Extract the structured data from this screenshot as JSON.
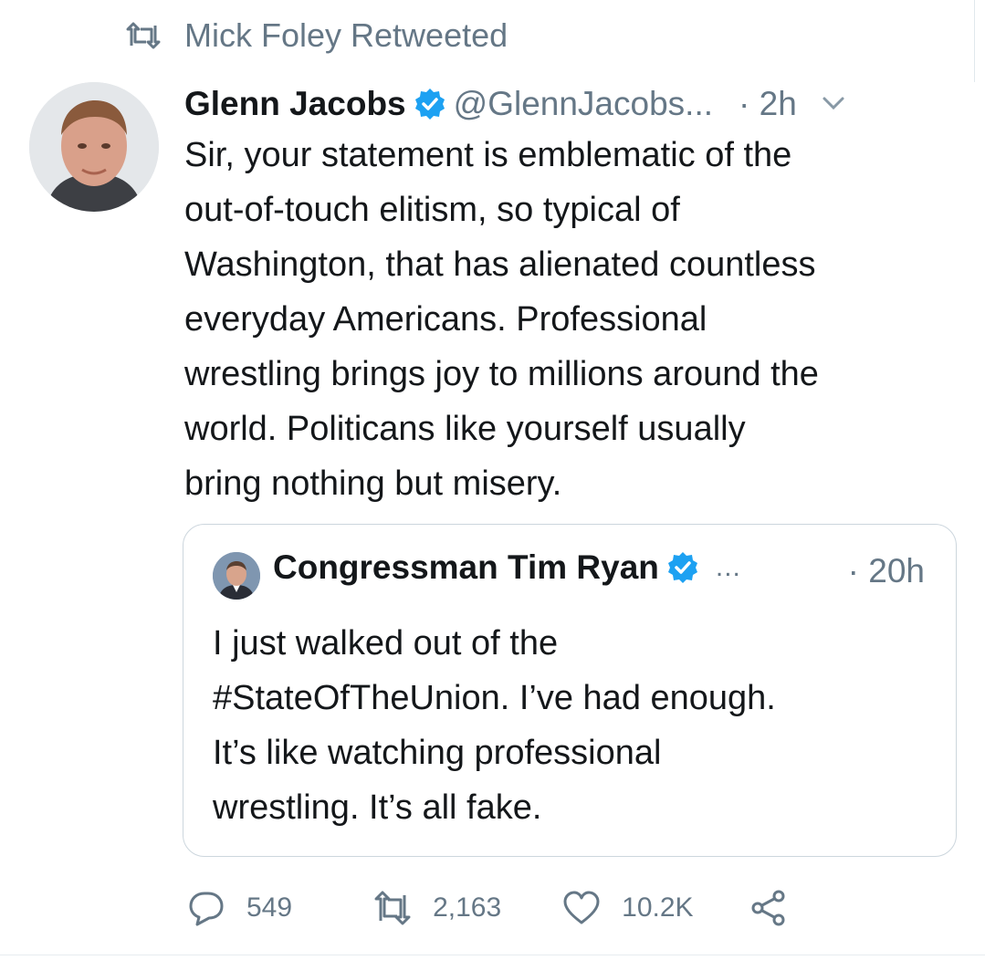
{
  "retweet_header": {
    "text": "Mick Foley Retweeted",
    "icon": "retweet-icon"
  },
  "tweet": {
    "display_name": "Glenn Jacobs",
    "verified": true,
    "handle": "@GlennJacobs...",
    "time": "· 2h",
    "text_lines": [
      "Sir, your statement is emblematic of the",
      "out-of-touch elitism, so typical of",
      "Washington, that has alienated countless",
      "everyday Americans. Professional",
      "wrestling brings joy to millions around the",
      "world. Politicans like yourself usually",
      "bring nothing but misery."
    ]
  },
  "quoted_tweet": {
    "display_name": "Congressman Tim Ryan",
    "verified": true,
    "ellipsis": "...",
    "time": "· 20h",
    "text_lines": [
      "I just walked out of the",
      "#StateOfTheUnion. I’ve had enough.",
      "It’s like watching professional",
      "wrestling. It’s all fake."
    ]
  },
  "actions": {
    "replies": "549",
    "retweets": "2,163",
    "likes": "10.2K",
    "share_icon": "share-icon"
  },
  "colors": {
    "text": "#14171a",
    "secondary": "#657786",
    "verified_blue": "#1da1f2",
    "border": "#ccd6dd"
  }
}
